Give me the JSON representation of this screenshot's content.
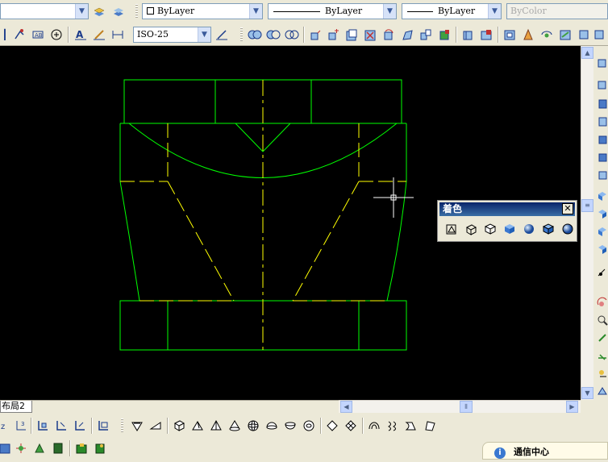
{
  "top_bar": {
    "color_dd": "ByLayer",
    "linetype_dd": "ByLayer",
    "lineweight_dd": "ByLayer",
    "plotstyle_dd": "ByColor"
  },
  "second_bar": {
    "dimstyle_dd": "ISO-25"
  },
  "layout_tab": {
    "label": "布局2"
  },
  "shade_panel": {
    "title": "着色",
    "close": "✕",
    "buttons": [
      "2d-wireframe-icon",
      "3d-wireframe-icon",
      "hidden-icon",
      "flat-shaded-icon",
      "gouraud-shaded-icon",
      "flat-edges-icon",
      "gouraud-edges-icon"
    ]
  },
  "comm_center": {
    "label": "通信中心"
  },
  "drawing_colors": {
    "outline": "#00ff00",
    "hidden": "#ffff00",
    "background": "#000000"
  }
}
